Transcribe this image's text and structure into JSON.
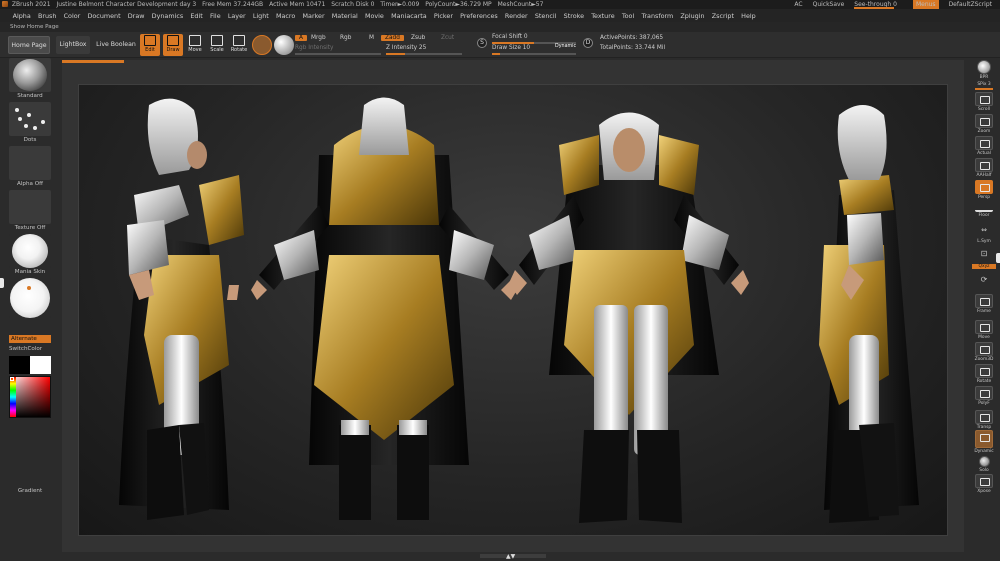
{
  "titlebar": {
    "app": "ZBrush 2021",
    "document": "Justine Belmont Character Development day 3",
    "free_mem": "Free Mem 37.244GB",
    "active_mem": "Active Mem 10471",
    "scratch": "Scratch Disk 0",
    "timer": "Timer►0.009",
    "polycount": "PolyCount►36.729 MP",
    "meshcount": "MeshCount►57",
    "ac": "AC",
    "quicksave": "QuickSave",
    "see_through": "See-through 0",
    "menus": "Menus",
    "default_script": "DefaultZScript"
  },
  "menubar": [
    "Alpha",
    "Brush",
    "Color",
    "Document",
    "Draw",
    "Dynamics",
    "Edit",
    "File",
    "Layer",
    "Light",
    "Macro",
    "Marker",
    "Material",
    "Movie",
    "Maniacarta",
    "Picker",
    "Preferences",
    "Render",
    "Stencil",
    "Stroke",
    "Texture",
    "Tool",
    "Transform",
    "Zplugin",
    "Zscript",
    "Help"
  ],
  "home_strip": "Show Home Page",
  "toolbar": {
    "home_page": "Home Page",
    "lightbox": "LightBox",
    "live_boolean": "Live Boolean",
    "edit": "Edit",
    "draw": "Draw",
    "move": "Move",
    "scale": "Scale",
    "rotate": "Rotate",
    "a_label": "A",
    "mrgb": "Mrgb",
    "rgb": "Rgb",
    "m": "M",
    "zadd": "Zadd",
    "zsub": "Zsub",
    "zcut": "Zcut",
    "rgb_intensity": "Rgb Intensity",
    "z_intensity": "Z Intensity 25",
    "focal_shift": "Focal Shift 0",
    "draw_size": "Draw Size 10",
    "dynamic": "Dynamic",
    "active_points": "ActivePoints: 387,065",
    "total_points": "TotalPoints: 33.744 Mil",
    "s_label": "S",
    "d_label": "D",
    "z_intensity_level": 0.25,
    "draw_size_level": 0.1
  },
  "left_shelf": {
    "standard": "Standard",
    "dots": "Dots",
    "alpha_off": "Alpha Off",
    "texture_off": "Texture Off",
    "material": "Mania Skin",
    "alternate": "Alternate",
    "switch_color": "SwitchColor",
    "gradient": "Gradient"
  },
  "right_shelf": {
    "bpr": "BPR",
    "spix": "SPix 3",
    "scroll": "Scroll",
    "zoom": "Zoom",
    "actual": "Actual",
    "aahalf": "AAHalf",
    "persp": "Persp",
    "floor": "Floor",
    "lsym": "L.Sym",
    "xyz": "Qxyz",
    "frame": "Frame",
    "move": "Move",
    "zoom3d": "Zoom3D",
    "rotate": "Rotate",
    "polyf": "PolyF",
    "transp": "Transp",
    "dynamic": "Dynamic",
    "solo": "Solo",
    "xpose": "Xpose"
  },
  "colors": {
    "accent": "#d97824",
    "gold": "#b8922e",
    "silver": "#d6d6d6",
    "cloth": "#0f0f0f"
  }
}
